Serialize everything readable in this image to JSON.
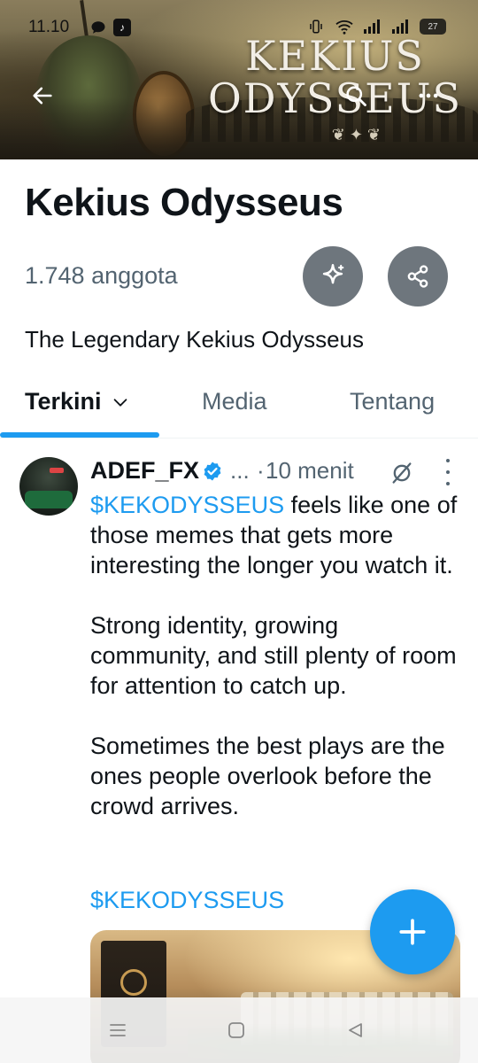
{
  "status_bar": {
    "time": "11.10",
    "battery": "27"
  },
  "banner": {
    "title_line1": "KEKIUS",
    "title_line2": "ODYSSEUS"
  },
  "community": {
    "name": "Kekius Odysseus",
    "members": "1.748 anggota",
    "description": "The Legendary Kekius Odysseus"
  },
  "tabs": [
    {
      "label": "Terkini",
      "active": true
    },
    {
      "label": "Media",
      "active": false
    },
    {
      "label": "Tentang",
      "active": false
    }
  ],
  "post": {
    "author": "ADEF_FX",
    "handle_truncated": "...",
    "separator": "·",
    "time": "10 menit",
    "body": {
      "p1_cashtag": "$KEKODYSSEUS",
      "p1_text": " feels like one of those memes that gets more interesting the longer you watch it.",
      "p2": "Strong identity, growing community, and still plenty of room for attention to catch up.",
      "p3": "Sometimes the best plays are the ones people overlook before the crowd arrives."
    },
    "tag": "$KEKODYSSEUS"
  },
  "icons": {
    "back": "arrow-left-icon",
    "search": "search-icon",
    "more": "more-horizontal-icon",
    "sparkle": "sparkle-icon",
    "share": "share-icon",
    "verified": "verified-badge-icon",
    "grok": "grok-icon",
    "compose": "plus-icon"
  },
  "colors": {
    "accent": "#1d9bf0",
    "secondary_text": "#536471",
    "action_button_bg": "#6e767d"
  }
}
